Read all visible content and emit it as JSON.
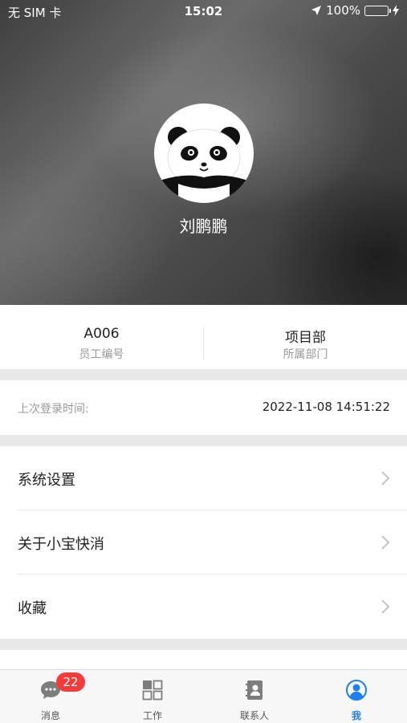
{
  "status_bar": {
    "carrier": "无 SIM 卡",
    "time": "15:02",
    "battery": "100%"
  },
  "profile": {
    "name": "刘鹏鹏"
  },
  "info": {
    "employee_id": "A006",
    "employee_id_label": "员工编号",
    "department": "项目部",
    "department_label": "所属部门"
  },
  "last_login": {
    "label": "上次登录时间:",
    "value": "2022-11-08 14:51:22"
  },
  "menu": [
    {
      "label": "系统设置"
    },
    {
      "label": "关于小宝快消"
    },
    {
      "label": "收藏"
    }
  ],
  "tabbar": {
    "tabs": [
      {
        "label": "消息",
        "icon": "chat-icon",
        "badge": "22"
      },
      {
        "label": "工作",
        "icon": "grid-icon"
      },
      {
        "label": "联系人",
        "icon": "contacts-icon"
      },
      {
        "label": "我",
        "icon": "user-icon"
      }
    ],
    "active_color": "#1a7ff5"
  }
}
